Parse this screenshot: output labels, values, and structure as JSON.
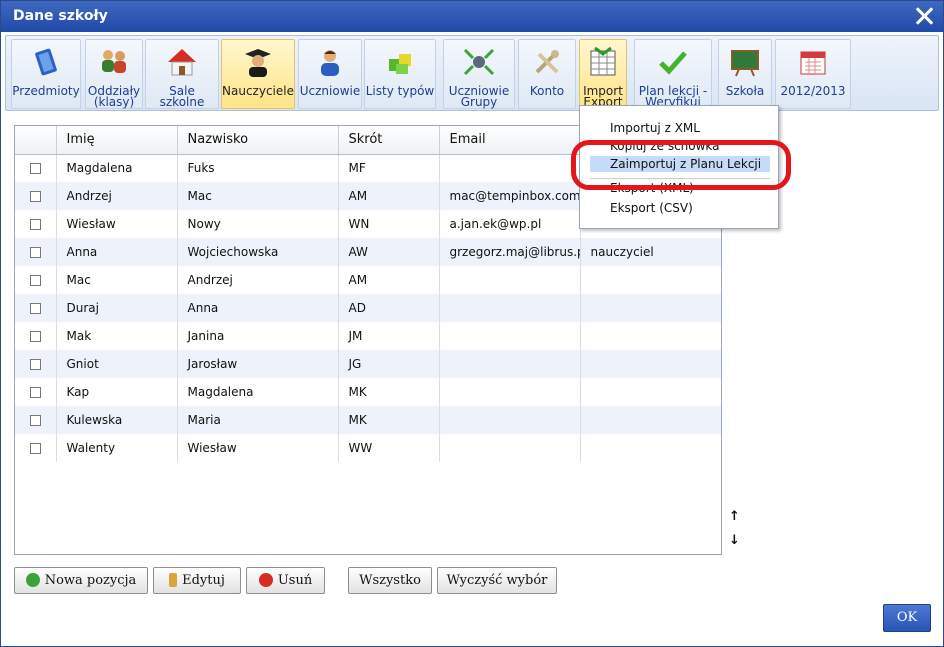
{
  "window": {
    "title": "Dane szkoły"
  },
  "toolbar": {
    "items": [
      {
        "label": "Przedmioty",
        "icon": "book-icon",
        "active": false
      },
      {
        "label": "Oddziały\n(klasy)",
        "icon": "group-icon",
        "active": false
      },
      {
        "label": "Sale szkolne",
        "icon": "house-icon",
        "active": false
      },
      {
        "label": "Nauczyciele",
        "icon": "teacher-icon",
        "active": true
      },
      {
        "label": "Uczniowie",
        "icon": "student-icon",
        "active": false
      },
      {
        "label": "Listy typów",
        "icon": "cubes-icon",
        "active": false
      },
      {
        "label": "Uczniowie\nGrupy",
        "icon": "student-groups-icon",
        "active": false
      },
      {
        "label": "Konto",
        "icon": "tools-icon",
        "active": false
      },
      {
        "label": "Import\nExport",
        "icon": "spreadsheet-icon",
        "active": false
      },
      {
        "label": "Plan lekcji -\nWeryfikuj",
        "icon": "checkmark-icon",
        "active": false
      },
      {
        "label": "Szkoła",
        "icon": "chalkboard-icon",
        "active": false
      },
      {
        "label": "2012/2013",
        "icon": "calendar-icon",
        "active": false
      }
    ]
  },
  "table": {
    "columns": [
      "Imię",
      "Nazwisko",
      "Skrót",
      "Email",
      ""
    ],
    "rows": [
      [
        "Magdalena",
        "Fuks",
        "MF",
        "",
        ""
      ],
      [
        "Andrzej",
        "Mac",
        "AM",
        "mac@tempinbox.com",
        ""
      ],
      [
        "Wiesław",
        "Nowy",
        "WN",
        "a.jan.ek@wp.pl",
        ""
      ],
      [
        "Anna",
        "Wojciechowska",
        "AW",
        "grzegorz.maj@librus.pl",
        "nauczyciel"
      ],
      [
        "Mac",
        "Andrzej",
        "AM",
        "",
        ""
      ],
      [
        "Duraj",
        "Anna",
        "AD",
        "",
        ""
      ],
      [
        "Mak",
        "Janina",
        "JM",
        "",
        ""
      ],
      [
        "Gniot",
        "Jarosław",
        "JG",
        "",
        ""
      ],
      [
        "Kap",
        "Magdalena",
        "MK",
        "",
        ""
      ],
      [
        "Kulewska",
        "Maria",
        "MK",
        "",
        ""
      ],
      [
        "Walenty",
        "Wiesław",
        "WW",
        "",
        ""
      ]
    ]
  },
  "scroll": {
    "up": "↑",
    "down": "↓"
  },
  "context_menu": {
    "items": [
      {
        "label": "Importuj z XML",
        "highlighted": false
      },
      {
        "label": "Kopiuj ze schowka",
        "highlighted": false
      },
      {
        "label": "Zaimportuj z Planu Lekcji",
        "highlighted": true
      },
      {
        "label": "Eksport (XML)",
        "highlighted": false
      },
      {
        "label": "Eksport (CSV)",
        "highlighted": false
      }
    ]
  },
  "buttons": {
    "new": "Nowa pozycja",
    "edit": "Edytuj",
    "delete": "Usuń",
    "all": "Wszystko",
    "clear": "Wyczyść wybór",
    "ok": "OK"
  },
  "colors": {
    "title_bar": "#2a55b5",
    "highlight_ring": "#e2161b",
    "active_tab": "#ffe486",
    "ok_button": "#2955b5"
  }
}
